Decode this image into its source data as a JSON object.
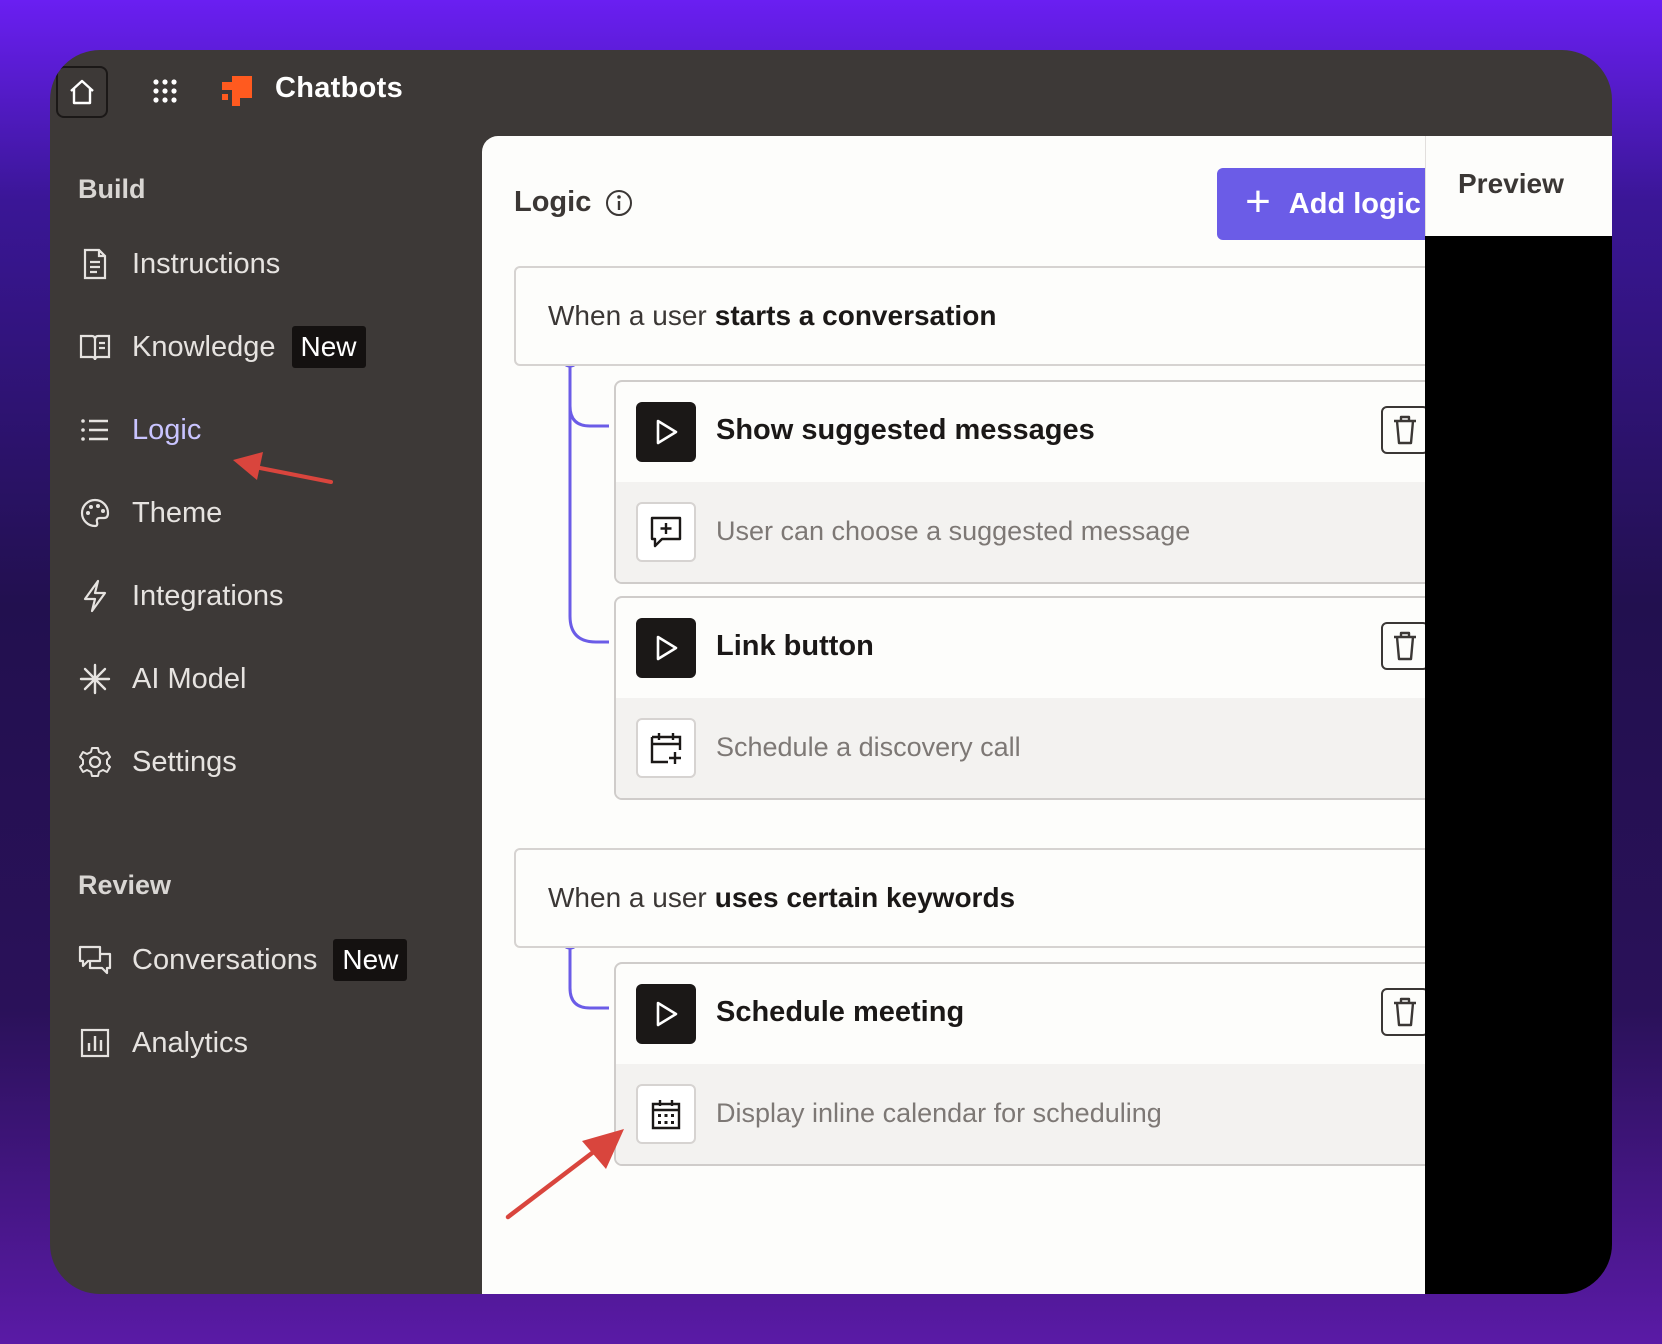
{
  "app": {
    "title": "Chatbots"
  },
  "sidebar": {
    "build_title": "Build",
    "review_title": "Review",
    "build_items": [
      {
        "label": "Instructions",
        "icon": "document-icon"
      },
      {
        "label": "Knowledge",
        "icon": "book-icon",
        "badge": "New"
      },
      {
        "label": "Logic",
        "icon": "list-icon",
        "active": true
      },
      {
        "label": "Theme",
        "icon": "palette-icon"
      },
      {
        "label": "Integrations",
        "icon": "lightning-icon"
      },
      {
        "label": "AI Model",
        "icon": "sparkle-icon"
      },
      {
        "label": "Settings",
        "icon": "gear-icon"
      }
    ],
    "review_items": [
      {
        "label": "Conversations",
        "icon": "chat-bubbles-icon",
        "badge": "New"
      },
      {
        "label": "Analytics",
        "icon": "bar-chart-icon"
      }
    ]
  },
  "main": {
    "title": "Logic",
    "add_button": "Add logic",
    "groups": [
      {
        "trigger_prefix": "When a user",
        "trigger_bold": "starts a conversation",
        "actions": [
          {
            "title": "Show suggested messages",
            "detail": "User can choose a suggested message",
            "detail_icon": "message-plus-icon"
          },
          {
            "title": "Link button",
            "detail": "Schedule a discovery call",
            "detail_icon": "calendar-plus-icon"
          }
        ]
      },
      {
        "trigger_prefix": "When a user",
        "trigger_bold": "uses certain keywords",
        "actions": [
          {
            "title": "Schedule meeting",
            "detail": "Display inline calendar for scheduling",
            "detail_icon": "calendar-grid-icon"
          }
        ]
      }
    ]
  },
  "preview": {
    "label": "Preview"
  },
  "colors": {
    "accent": "#6b5ce7",
    "sidebar_bg": "#3d3937",
    "annotation_red": "#d9453d",
    "connector": "#6b5ce7"
  }
}
